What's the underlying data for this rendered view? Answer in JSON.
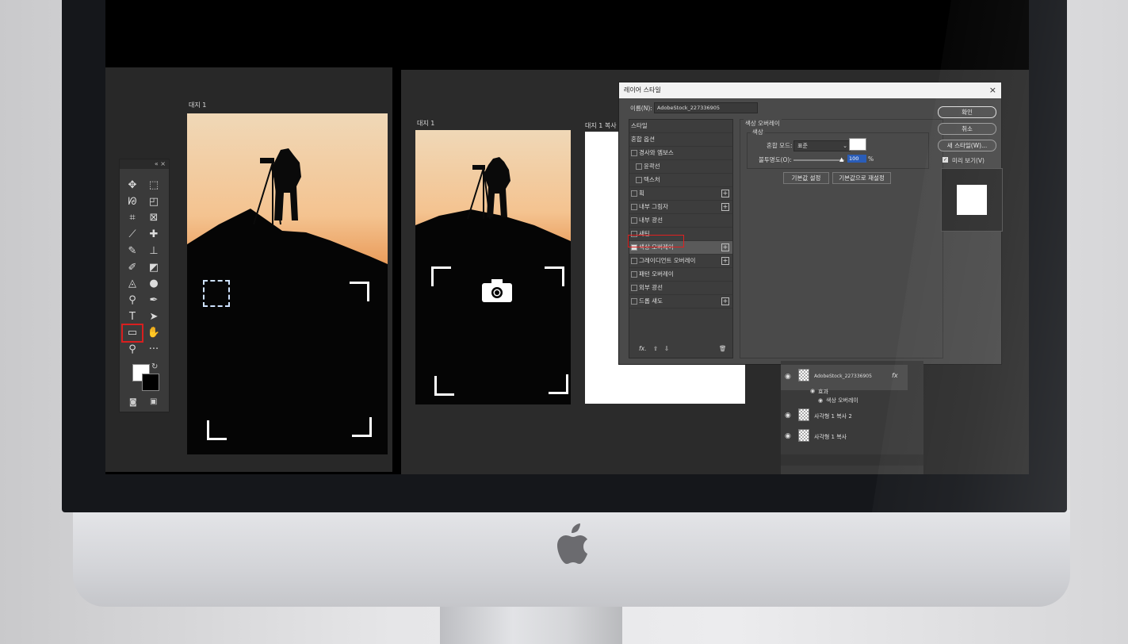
{
  "artboards": {
    "left_label": "대지 1",
    "middle_label": "대지 1",
    "right_label": "대지 1 복사"
  },
  "toolbar": {
    "header": "« ×",
    "tools": [
      {
        "icon": "move-icon",
        "glyph": "✥"
      },
      {
        "icon": "marquee-icon",
        "glyph": "⬚"
      },
      {
        "icon": "lasso-icon",
        "glyph": "ᘘ"
      },
      {
        "icon": "object-select-icon",
        "glyph": "◰"
      },
      {
        "icon": "crop-icon",
        "glyph": "⌗"
      },
      {
        "icon": "frame-icon",
        "glyph": "⊠"
      },
      {
        "icon": "eyedropper-icon",
        "glyph": "⟋"
      },
      {
        "icon": "healing-icon",
        "glyph": "✚"
      },
      {
        "icon": "brush-icon",
        "glyph": "✎"
      },
      {
        "icon": "stamp-icon",
        "glyph": "⊥"
      },
      {
        "icon": "history-brush-icon",
        "glyph": "✐"
      },
      {
        "icon": "eraser-icon",
        "glyph": "◩"
      },
      {
        "icon": "paint-bucket-icon",
        "glyph": "◬"
      },
      {
        "icon": "blur-icon",
        "glyph": "●"
      },
      {
        "icon": "dodge-icon",
        "glyph": "⚲"
      },
      {
        "icon": "pen-icon",
        "glyph": "✒"
      },
      {
        "icon": "type-icon",
        "glyph": "T"
      },
      {
        "icon": "path-select-icon",
        "glyph": "➤"
      },
      {
        "icon": "rectangle-icon",
        "glyph": "▭"
      },
      {
        "icon": "hand-icon",
        "glyph": "✋"
      },
      {
        "icon": "zoom-icon",
        "glyph": "⚲"
      },
      {
        "icon": "more-icon",
        "glyph": "···"
      }
    ]
  },
  "dialog": {
    "title": "레이어 스타일",
    "close": "×",
    "name_label": "이름(N):",
    "name_value": "AdobeStock_227336905",
    "list_header": "스타일",
    "blend_options": "혼합 옵션",
    "styles": [
      {
        "label": "경사와 엠보스",
        "checked": false,
        "plus": false,
        "indent": false
      },
      {
        "label": "윤곽선",
        "checked": false,
        "plus": false,
        "indent": true
      },
      {
        "label": "텍스처",
        "checked": false,
        "plus": false,
        "indent": true
      },
      {
        "label": "획",
        "checked": false,
        "plus": true,
        "indent": false
      },
      {
        "label": "내부 그림자",
        "checked": false,
        "plus": true,
        "indent": false
      },
      {
        "label": "내부 광선",
        "checked": false,
        "plus": false,
        "indent": false
      },
      {
        "label": "새틴",
        "checked": false,
        "plus": false,
        "indent": false
      },
      {
        "label": "색상 오버레이",
        "checked": true,
        "plus": true,
        "indent": false
      },
      {
        "label": "그레이디언트 오버레이",
        "checked": false,
        "plus": true,
        "indent": false
      },
      {
        "label": "패턴 오버레이",
        "checked": false,
        "plus": false,
        "indent": false
      },
      {
        "label": "외부 광선",
        "checked": false,
        "plus": false,
        "indent": false
      },
      {
        "label": "드롭 섀도",
        "checked": false,
        "plus": true,
        "indent": false
      }
    ],
    "footer_fx": "fx.",
    "section_title": "색상 오버레이",
    "section_sub": "색상",
    "blend_mode_label": "혼합 모드:",
    "blend_mode_value": "표준",
    "opacity_label": "불투명도(O):",
    "opacity_value": "100",
    "opacity_unit": "%",
    "overlay_color": "#ffffff",
    "btn_default": "기본값 설정",
    "btn_reset": "기본값으로 재설정",
    "btn_ok": "확인",
    "btn_cancel": "취소",
    "btn_new_style": "새 스타일(W)...",
    "preview_label": "미리 보기(V)",
    "preview_checked": true
  },
  "layers": {
    "layer_main": "AdobeStock_227336905",
    "fx_badge": "fx",
    "effects_label": "효과",
    "effect_item": "색상 오버레이",
    "layer_2": "사각형 1 복사 2",
    "layer_3": "사각형 1 복사"
  }
}
